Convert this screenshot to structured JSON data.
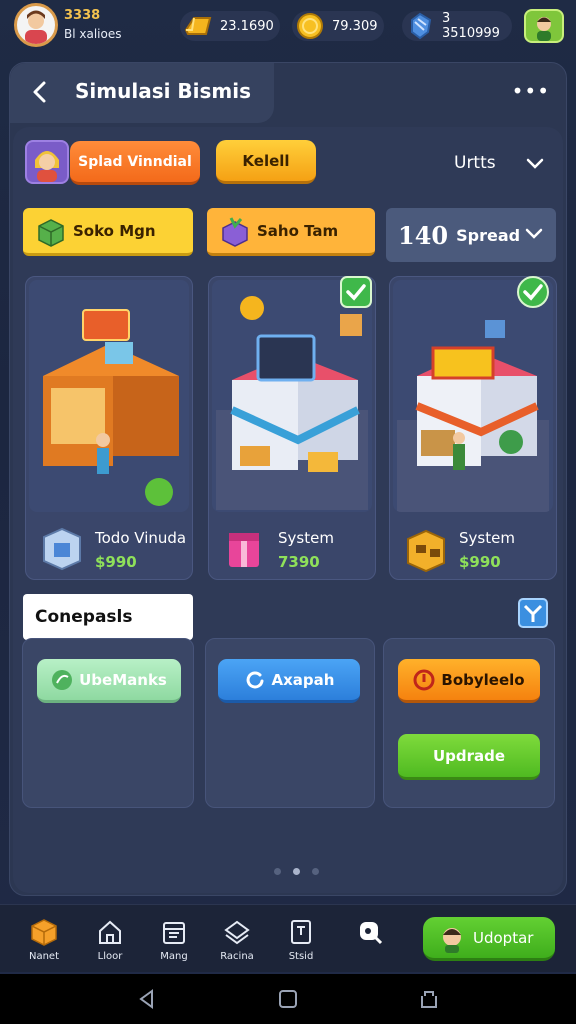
{
  "player": {
    "level": "3338",
    "subtitle": "Bl xalioes"
  },
  "resources": [
    {
      "icon": "gold-bar-icon",
      "value": "23.1690"
    },
    {
      "icon": "coin-icon",
      "value": "79.309"
    },
    {
      "icon": "gem-icon",
      "value": "3 3510999"
    }
  ],
  "header": {
    "title": "Simulasi Bismis"
  },
  "row1": {
    "virtual_label": "Splad Vinndial",
    "kelei_label": "Kelell",
    "urtts_label": "Urtts"
  },
  "tabs": [
    {
      "label": "Soko Mgn",
      "icon": "green-box-icon"
    },
    {
      "label": "Saho Tam",
      "icon": "purple-box-icon"
    }
  ],
  "spread": {
    "number": "140",
    "label": "Spread"
  },
  "stores": [
    {
      "name": "Todo Vinuda",
      "price": "$990",
      "icon": "package-icon",
      "checked": false
    },
    {
      "name": "System",
      "price": "7390",
      "icon": "gift-box-icon",
      "checked": true
    },
    {
      "name": "System",
      "price": "$990",
      "icon": "crate-icon",
      "checked": true
    }
  ],
  "conspects": {
    "label": "Conepasls",
    "buttons": {
      "col1": "UbeManks",
      "col2": "Axapah",
      "col3_top": "Bobyleelo",
      "col3_bottom": "Updrade"
    }
  },
  "nav": [
    {
      "label": "Nanet",
      "icon": "box-icon"
    },
    {
      "label": "Lloor",
      "icon": "home-icon"
    },
    {
      "label": "Mang",
      "icon": "calendar-icon"
    },
    {
      "label": "Racina",
      "icon": "layers-icon"
    },
    {
      "label": "Stsid",
      "icon": "document-icon"
    },
    {
      "label": "",
      "icon": "search-icon"
    }
  ],
  "update": {
    "label": "Udoptar"
  },
  "colors": {
    "accent_orange": "#f36a1a",
    "accent_yellow": "#fcd234",
    "accent_green": "#4fba21",
    "price_green": "#8fe15a"
  }
}
